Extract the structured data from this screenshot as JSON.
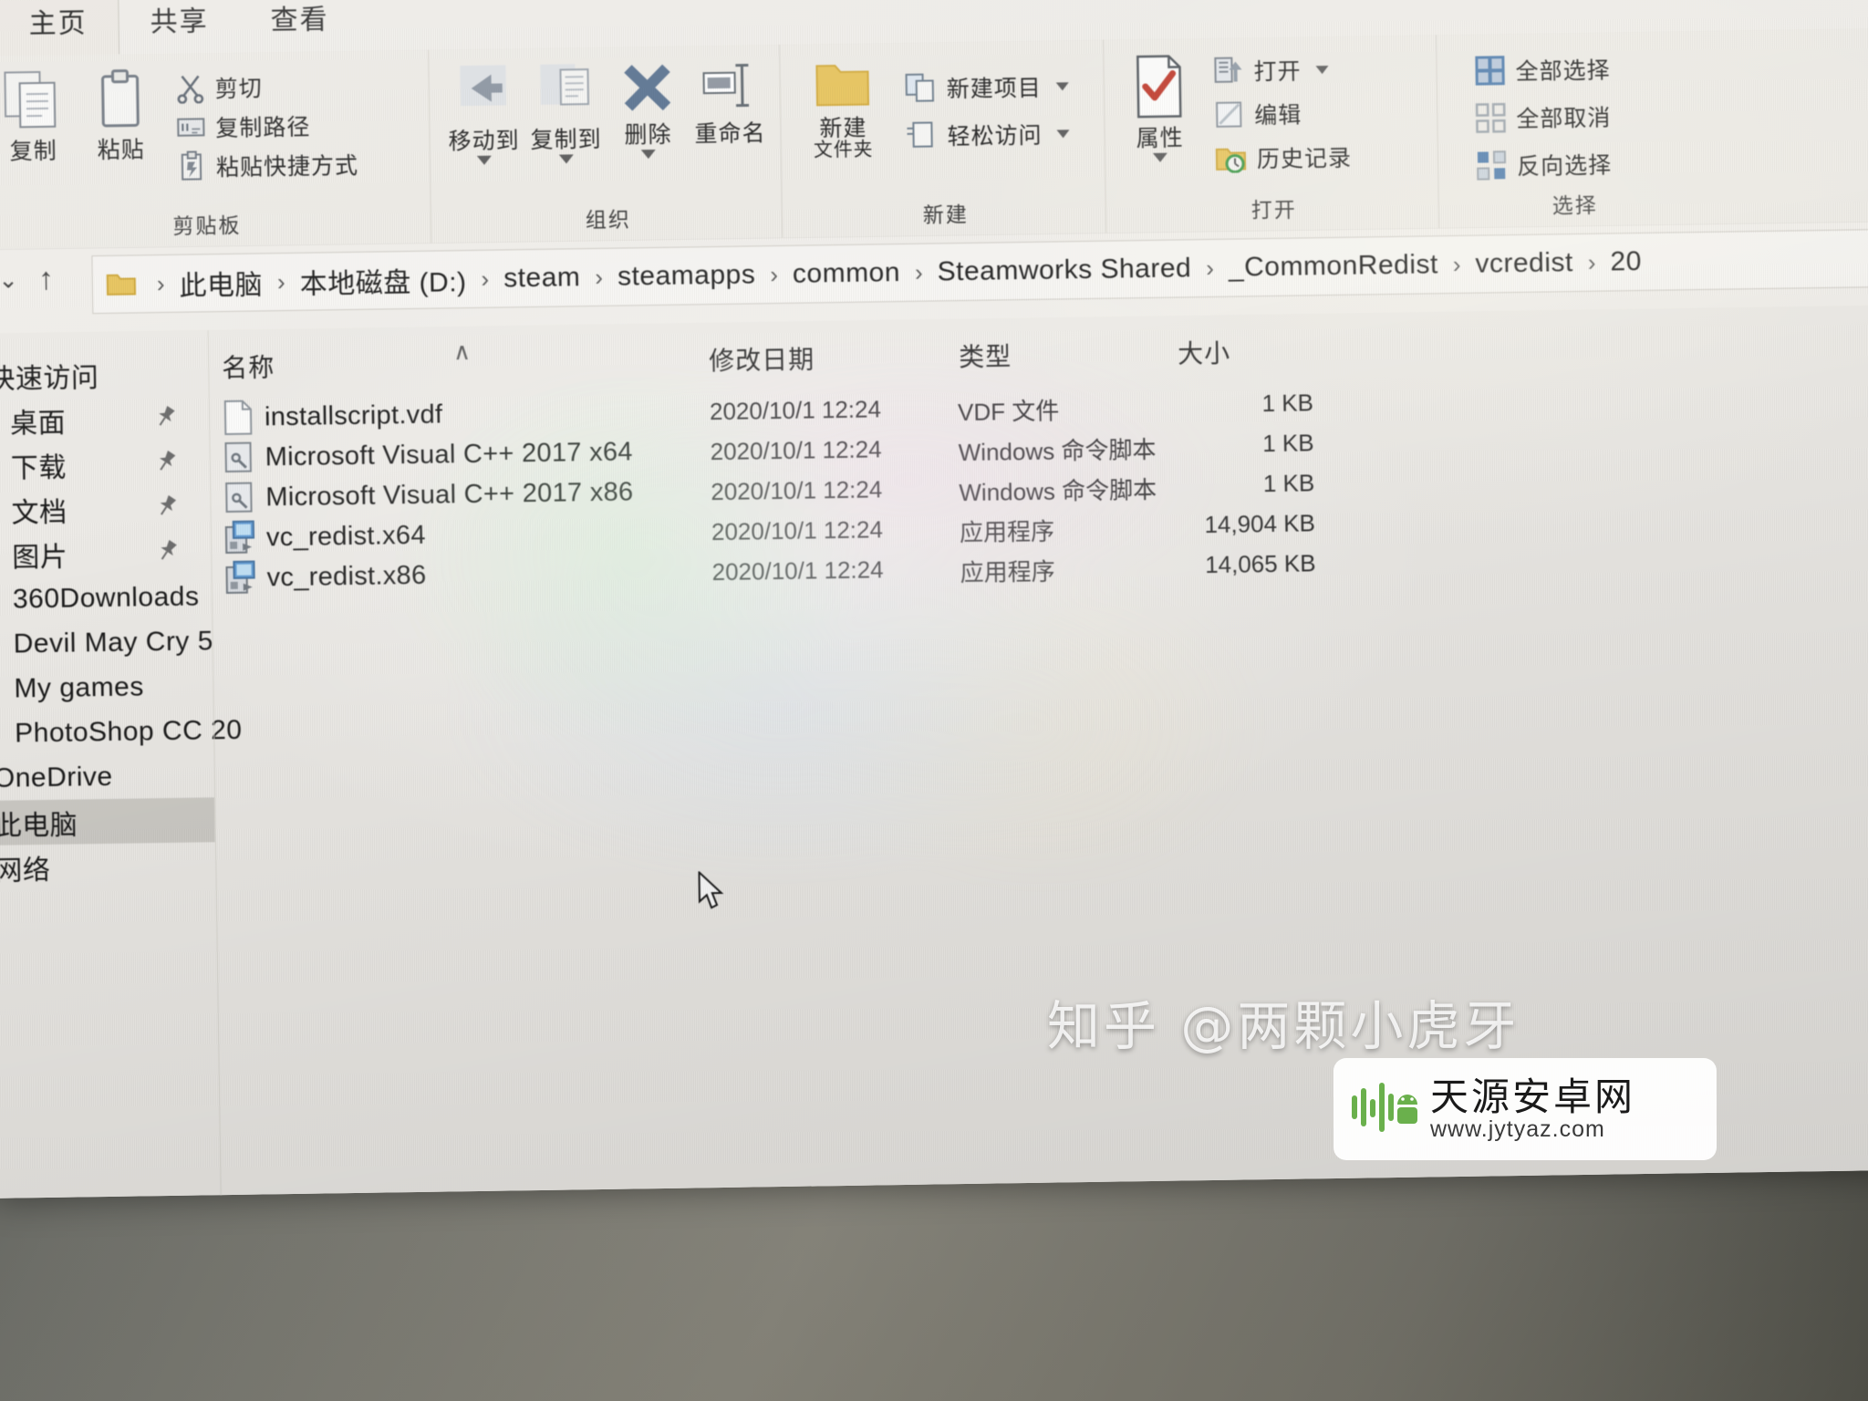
{
  "window": {
    "app": "Windows 文件资源管理器",
    "tabs": [
      {
        "label": "主页",
        "active": true
      },
      {
        "label": "共享",
        "active": false
      },
      {
        "label": "查看",
        "active": false
      }
    ]
  },
  "ribbon": {
    "groups": [
      {
        "title": "剪贴板",
        "big": [
          {
            "label": "复制",
            "icon": "copy-icon"
          },
          {
            "label": "粘贴",
            "icon": "paste-icon"
          }
        ],
        "small": [
          {
            "label": "剪切",
            "icon": "scissors-icon"
          },
          {
            "label": "复制路径",
            "icon": "copy-path-icon"
          },
          {
            "label": "粘贴快捷方式",
            "icon": "paste-shortcut-icon"
          }
        ]
      },
      {
        "title": "组织",
        "big": [
          {
            "label": "移动到",
            "icon": "move-to-icon",
            "dropdown": true
          },
          {
            "label": "复制到",
            "icon": "copy-to-icon",
            "dropdown": true
          },
          {
            "label": "删除",
            "icon": "delete-x-icon",
            "dropdown": true
          },
          {
            "label": "重命名",
            "icon": "rename-icon"
          }
        ],
        "small": []
      },
      {
        "title": "新建",
        "big": [
          {
            "label": "新建",
            "label2": "文件夹",
            "icon": "new-folder-icon"
          }
        ],
        "small": [
          {
            "label": "新建项目",
            "icon": "new-item-icon",
            "dropdown": true
          },
          {
            "label": "轻松访问",
            "icon": "easy-access-icon",
            "dropdown": true
          }
        ]
      },
      {
        "title": "打开",
        "big": [
          {
            "label": "属性",
            "icon": "properties-icon",
            "dropdown": true
          }
        ],
        "small": [
          {
            "label": "打开",
            "icon": "open-icon",
            "dropdown": true
          },
          {
            "label": "编辑",
            "icon": "edit-icon"
          },
          {
            "label": "历史记录",
            "icon": "history-icon"
          }
        ]
      },
      {
        "title": "选择",
        "big": [],
        "small": [
          {
            "label": "全部选择",
            "icon": "select-all-icon"
          },
          {
            "label": "全部取消",
            "icon": "select-none-icon"
          },
          {
            "label": "反向选择",
            "icon": "invert-selection-icon"
          }
        ]
      }
    ]
  },
  "address": {
    "back_icon": "back-arrow-icon",
    "forward_icon": "forward-arrow-icon",
    "recent_icon": "chevron-down-icon",
    "up_icon": "up-arrow-icon",
    "folder_icon": "folder-icon",
    "crumbs": [
      "此电脑",
      "本地磁盘 (D:)",
      "steam",
      "steamapps",
      "common",
      "Steamworks Shared",
      "_CommonRedist",
      "vcredist",
      "20"
    ],
    "separator": "›"
  },
  "sidebar": {
    "items": [
      {
        "label": "快速访问",
        "icon": "quick-access-icon",
        "pinned": false,
        "indent": false,
        "selected": false
      },
      {
        "label": "桌面",
        "icon": "desktop-icon",
        "pinned": true,
        "indent": true,
        "selected": false
      },
      {
        "label": "下载",
        "icon": "downloads-icon",
        "pinned": true,
        "indent": true,
        "selected": false
      },
      {
        "label": "文档",
        "icon": "documents-icon",
        "pinned": true,
        "indent": true,
        "selected": false
      },
      {
        "label": "图片",
        "icon": "pictures-icon",
        "pinned": true,
        "indent": true,
        "selected": false
      },
      {
        "label": "360Downloads",
        "icon": "folder-icon",
        "pinned": false,
        "indent": true,
        "selected": false
      },
      {
        "label": "Devil May Cry 5",
        "icon": "folder-icon",
        "pinned": false,
        "indent": true,
        "selected": false
      },
      {
        "label": "My games",
        "icon": "folder-icon",
        "pinned": false,
        "indent": true,
        "selected": false
      },
      {
        "label": "PhotoShop CC 20",
        "icon": "folder-icon",
        "pinned": false,
        "indent": true,
        "selected": false
      },
      {
        "label": "OneDrive",
        "icon": "onedrive-icon",
        "pinned": false,
        "indent": false,
        "selected": false
      },
      {
        "label": "此电脑",
        "icon": "this-pc-icon",
        "pinned": false,
        "indent": false,
        "selected": true
      },
      {
        "label": "网络",
        "icon": "network-icon",
        "pinned": false,
        "indent": false,
        "selected": false
      }
    ]
  },
  "filelist": {
    "columns": [
      "名称",
      "修改日期",
      "类型",
      "大小"
    ],
    "sort_indicator": "∧",
    "rows": [
      {
        "name": "installscript.vdf",
        "date": "2020/10/1 12:24",
        "type": "VDF 文件",
        "size": "1 KB",
        "icon": "generic-file-icon"
      },
      {
        "name": "Microsoft Visual C++ 2017 x64",
        "date": "2020/10/1 12:24",
        "type": "Windows 命令脚本",
        "size": "1 KB",
        "icon": "batch-script-icon"
      },
      {
        "name": "Microsoft Visual C++ 2017 x86",
        "date": "2020/10/1 12:24",
        "type": "Windows 命令脚本",
        "size": "1 KB",
        "icon": "batch-script-icon"
      },
      {
        "name": "vc_redist.x64",
        "date": "2020/10/1 12:24",
        "type": "应用程序",
        "size": "14,904 KB",
        "icon": "installer-exe-icon"
      },
      {
        "name": "vc_redist.x86",
        "date": "2020/10/1 12:24",
        "type": "应用程序",
        "size": "14,065 KB",
        "icon": "installer-exe-icon"
      }
    ]
  },
  "watermarks": {
    "zhihu": "知乎 @两颗小虎牙",
    "site_name": "天源安卓网",
    "site_url": "www.jytyaz.com"
  },
  "colors": {
    "accent": "#1f3864",
    "selection": "#cfcdc8",
    "folder_yellow": "#e8c45c",
    "delete_blue": "#5a7391",
    "check_red": "#c0392b",
    "badge_green": "#6ab04c"
  }
}
